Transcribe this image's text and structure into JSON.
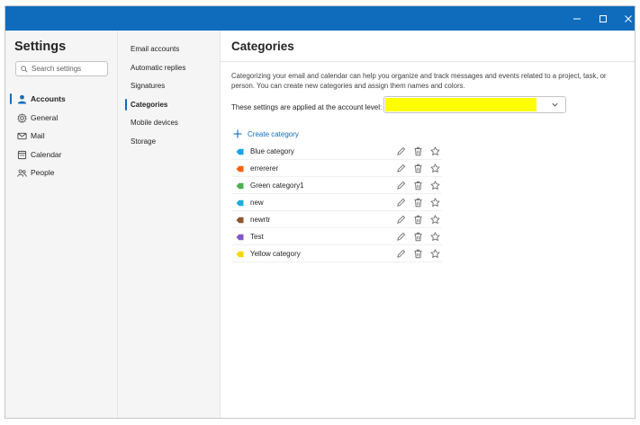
{
  "window": {
    "controls": {
      "minimize_icon": "minimize-icon",
      "maximize_icon": "maximize-icon",
      "close_icon": "close-icon"
    }
  },
  "sidebar": {
    "title": "Settings",
    "search": {
      "placeholder": "Search settings",
      "value": ""
    },
    "items": [
      {
        "label": "Accounts",
        "icon": "person-icon",
        "selected": true
      },
      {
        "label": "General",
        "icon": "gear-icon",
        "selected": false
      },
      {
        "label": "Mail",
        "icon": "mail-icon",
        "selected": false
      },
      {
        "label": "Calendar",
        "icon": "calendar-icon",
        "selected": false
      },
      {
        "label": "People",
        "icon": "people-icon",
        "selected": false
      }
    ]
  },
  "subnav": {
    "items": [
      {
        "label": "Email accounts",
        "selected": false
      },
      {
        "label": "Automatic replies",
        "selected": false
      },
      {
        "label": "Signatures",
        "selected": false
      },
      {
        "label": "Categories",
        "selected": true
      },
      {
        "label": "Mobile devices",
        "selected": false
      },
      {
        "label": "Storage",
        "selected": false
      }
    ]
  },
  "main": {
    "title": "Categories",
    "description": "Categorizing your email and calendar can help you organize and track messages and events related to a project, task, or person. You can create new categories and assign them names and colors.",
    "account_label": "These settings are applied at the account level:",
    "account_value": "",
    "create_label": "Create category",
    "categories": [
      {
        "name": "Blue category",
        "color": "#1aa3e8"
      },
      {
        "name": "errererer",
        "color": "#f7630c"
      },
      {
        "name": "Green category1",
        "color": "#4caf50"
      },
      {
        "name": "new",
        "color": "#1ab0d8"
      },
      {
        "name": "newrtr",
        "color": "#8e562e"
      },
      {
        "name": "Test",
        "color": "#7e57c2"
      },
      {
        "name": "Yellow category",
        "color": "#f5d800"
      }
    ]
  },
  "colors": {
    "accent": "#0f6cbd",
    "highlight": "#ffff00"
  }
}
